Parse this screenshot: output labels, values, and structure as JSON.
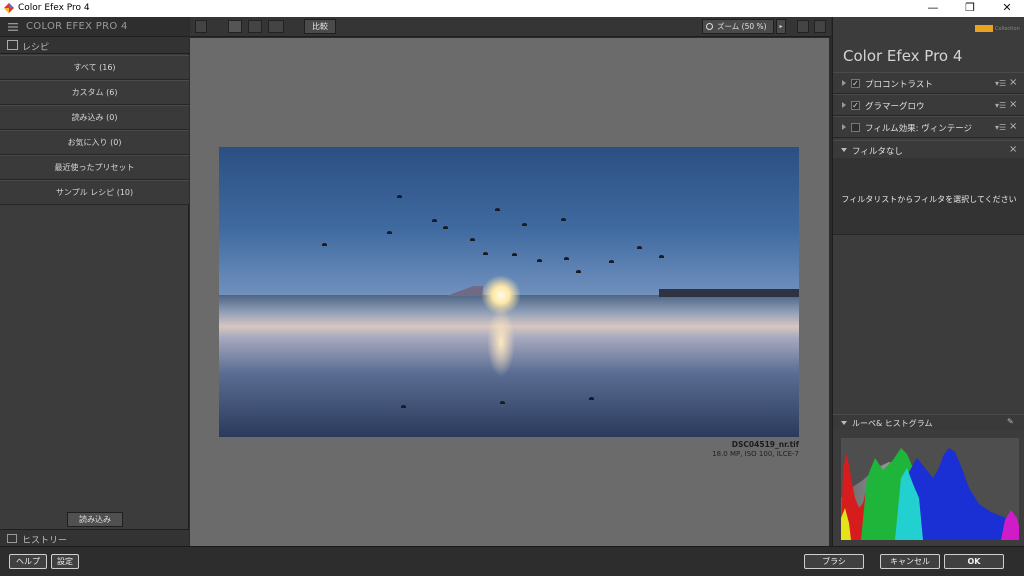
{
  "window": {
    "title": "Color Efex Pro 4",
    "controls": [
      "—",
      "❐",
      "✕"
    ]
  },
  "left_panel": {
    "brand": "COLOR EFEX PRO 4",
    "recipes_label": "レシピ",
    "recipes": [
      {
        "label": "すべて (16)"
      },
      {
        "label": "カスタム (6)"
      },
      {
        "label": "読み込み (0)"
      },
      {
        "label": "お気に入り (0)"
      },
      {
        "label": "最近使ったプリセット"
      },
      {
        "label": "サンプル レシピ (10)"
      }
    ],
    "load_button": "読み込み",
    "history_label": "ヒストリー"
  },
  "toolbar": {
    "compare_label": "比較",
    "zoom_label": "ズーム (50 %)"
  },
  "preview": {
    "file_name": "DSC04519_nr.tif",
    "file_meta": "18.0 MP, ISO 100, ILCE-7"
  },
  "right_panel": {
    "logo_text": "Collection",
    "title": "Color Efex Pro",
    "title_version": "4",
    "filters": [
      {
        "label": "プロコントラスト",
        "checked": true,
        "check_glyph": "✓"
      },
      {
        "label": "グラマーグロウ",
        "checked": true,
        "check_glyph": "✓"
      },
      {
        "label": "フィルム効果: ヴィンテージ",
        "checked": false,
        "check_glyph": ""
      }
    ],
    "no_filter_label": "フィルタなし",
    "no_filter_message": "フィルタリストからフィルタを選択してください",
    "histogram_label": "ルーペ& ヒストグラム"
  },
  "bottom_bar": {
    "help": "ヘルプ",
    "settings": "設定",
    "brush": "ブラシ",
    "cancel": "キャンセル",
    "ok": "OK"
  },
  "colors": {
    "panel": "#3c3c3c",
    "canvas": "#6b6b6b",
    "accent_logo": "#e8a21f"
  }
}
